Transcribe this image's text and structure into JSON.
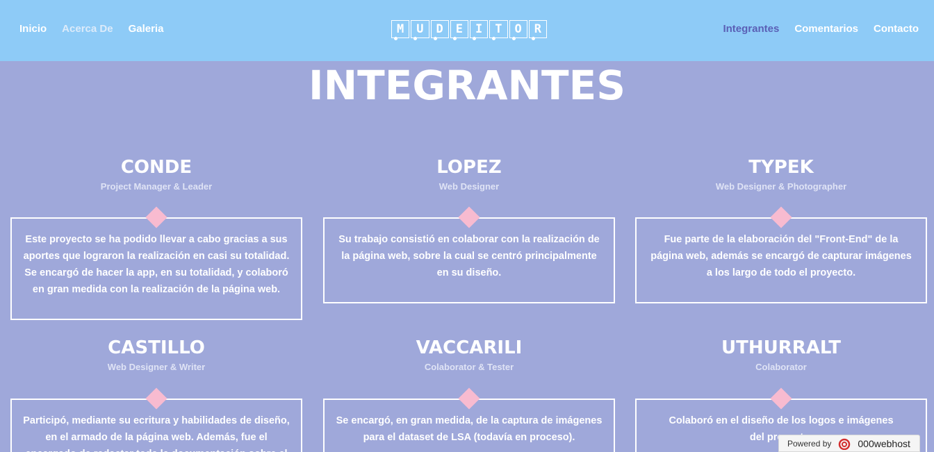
{
  "nav": {
    "left": [
      "Inicio",
      "Acerca De",
      "Galeria"
    ],
    "right": [
      "Integrantes",
      "Comentarios",
      "Contacto"
    ],
    "active": "Integrantes"
  },
  "logo": {
    "letters": [
      "M",
      "U",
      "D",
      "E",
      "I",
      "T",
      "O",
      "R"
    ]
  },
  "page": {
    "title": "INTEGRANTES"
  },
  "members": [
    {
      "name": "CONDE",
      "role": "Project Manager & Leader",
      "text": "Este proyecto se ha podido llevar a cabo gracias a sus aportes que lograron la realización en casi su totalidad. Se encargó de hacer la app, en su totalidad, y colaboró en gran medida con la realización de la página web."
    },
    {
      "name": "LOPEZ",
      "role": "Web Designer",
      "text": "Su trabajo consistió en colaborar con la realización de la página web, sobre la cual se centró principalmente en su diseño."
    },
    {
      "name": "TYPEK",
      "role": "Web Designer & Photographer",
      "text": "Fue parte de la elaboración del \"Front-End\" de la página web, además se encargó de capturar imágenes a los largo de todo el proyecto."
    },
    {
      "name": "CASTILLO",
      "role": "Web Designer & Writer",
      "text": "Participó, mediante su ecritura y habilidades de diseño, en el armado de la página web. Además, fue el encargado de redactar toda la documentación sobre el"
    },
    {
      "name": "VACCARILI",
      "role": "Colaborator & Tester",
      "text": "Se encargó, en gran medida, de la captura de imágenes para el dataset de LSA (todavía en proceso)."
    },
    {
      "name": "UTHURRALT",
      "role": "Colaborator",
      "text": "Colaboró en el diseño de los logos e imágenes del proyecto."
    }
  ],
  "badge": {
    "label": "Powered by",
    "brand": "000webhost"
  },
  "colors": {
    "background": "#9fa8da",
    "navbar": "#8ecbf7",
    "active_link": "#5a5fb5",
    "diamond": "#f8bbd0"
  }
}
